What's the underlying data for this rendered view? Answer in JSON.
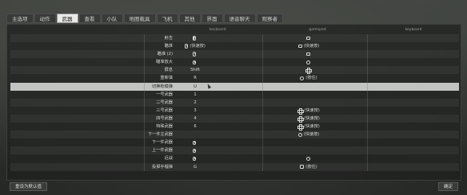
{
  "tabs": [
    {
      "label": "主选项",
      "active": false
    },
    {
      "label": "动作",
      "active": false
    },
    {
      "label": "武器",
      "active": true
    },
    {
      "label": "查看",
      "active": false
    },
    {
      "label": "小队",
      "active": false
    },
    {
      "label": "地图载具",
      "active": false
    },
    {
      "label": "飞机",
      "active": false
    },
    {
      "label": "其他",
      "active": false
    },
    {
      "label": "界面",
      "active": false
    },
    {
      "label": "语音聊天",
      "active": false
    },
    {
      "label": "观察者",
      "active": false
    }
  ],
  "columns": {
    "keyboard": "keyboard",
    "gamepad": "gamepad",
    "keyboard2": "keyboard"
  },
  "rows": [
    {
      "label": "射击",
      "kb_icon": "mouse-left-icon",
      "kb_text": "",
      "gp_icon": "gamepad-trigger-icon",
      "gp_text": ""
    },
    {
      "label": "瞄准",
      "kb_icon": "mouse-right-icon",
      "kb_text": "(快速按)",
      "gp_icon": "gamepad-trigger-icon",
      "gp_text": "(快速按)"
    },
    {
      "label": "瞄准 (2)",
      "kb_icon": "mouse-right-icon",
      "kb_text": "",
      "gp_icon": "gamepad-trigger-icon",
      "gp_text": ""
    },
    {
      "label": "瞄准放大",
      "kb_icon": "mouse-right-icon",
      "kb_text": "",
      "gp_icon": "gamepad-stick-icon",
      "gp_text": ""
    },
    {
      "label": "屏息",
      "kb_icon": "",
      "kb_text": "Shift",
      "gp_icon": "gamepad-dpad-icon",
      "gp_text": ""
    },
    {
      "label": "重新填",
      "kb_icon": "",
      "kb_text": "R",
      "gp_icon": "gamepad-button-icon",
      "gp_text": "(按住)"
    },
    {
      "label": "切换枪模弹",
      "kb_icon": "",
      "kb_text": "U",
      "gp_icon": "",
      "gp_text": ""
    },
    {
      "label": "一号武器",
      "kb_icon": "",
      "kb_text": "1",
      "gp_icon": "",
      "gp_text": ""
    },
    {
      "label": "二号武器",
      "kb_icon": "",
      "kb_text": "2",
      "gp_icon": "",
      "gp_text": ""
    },
    {
      "label": "三号武器",
      "kb_icon": "",
      "kb_text": "3",
      "gp_icon": "gamepad-dpad-icon",
      "gp_text": "(快速按)"
    },
    {
      "label": "四号武器",
      "kb_icon": "",
      "kb_text": "4",
      "gp_icon": "gamepad-dpad-icon",
      "gp_text": "(快速按)"
    },
    {
      "label": "特殊武器",
      "kb_icon": "",
      "kb_text": "6",
      "gp_icon": "gamepad-dpad-icon",
      "gp_text": "(快速按)"
    },
    {
      "label": "下一件主武器",
      "kb_icon": "",
      "kb_text": "",
      "gp_icon": "gamepad-button-icon",
      "gp_text": "(快速按)"
    },
    {
      "label": "下一件武器",
      "kb_icon": "mouse-wheel-icon",
      "kb_text": "",
      "gp_icon": "",
      "gp_text": ""
    },
    {
      "label": "上一件武器",
      "kb_icon": "mouse-wheel-icon",
      "kb_text": "",
      "gp_icon": "",
      "gp_text": ""
    },
    {
      "label": "近战",
      "kb_icon": "mouse-middle-icon",
      "kb_text": "",
      "gp_icon": "gamepad-stick-icon",
      "gp_text": ""
    },
    {
      "label": "投掷手榴弹",
      "kb_icon": "",
      "kb_text": "G",
      "gp_icon": "gamepad-shoulder-icon",
      "gp_text": "(按住)"
    }
  ],
  "highlight_row_index": 6,
  "buttons": {
    "reset": "重设为默认值",
    "ok": "确定"
  }
}
